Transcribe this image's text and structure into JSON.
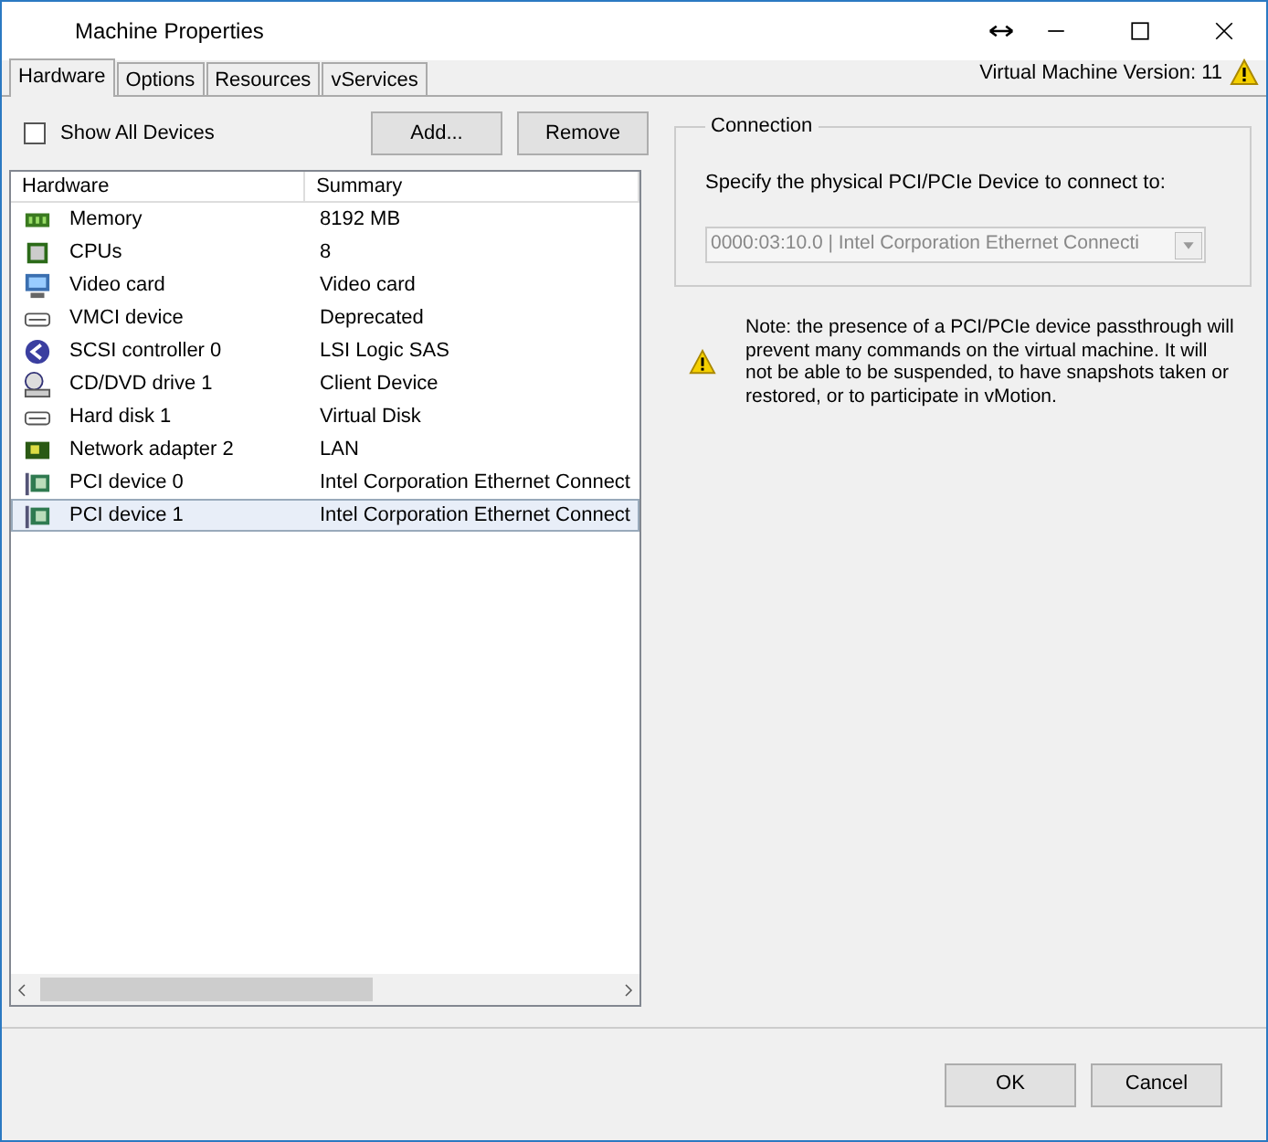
{
  "window": {
    "title": "Machine Properties"
  },
  "tabs": [
    {
      "label": "Hardware",
      "selected": true
    },
    {
      "label": "Options",
      "selected": false
    },
    {
      "label": "Resources",
      "selected": false
    },
    {
      "label": "vServices",
      "selected": false
    }
  ],
  "version": "Virtual Machine Version: 11",
  "show_all_devices": {
    "label": "Show All Devices",
    "checked": false
  },
  "buttons": [
    "Add...",
    "Remove"
  ],
  "table": {
    "columns": [
      "Hardware",
      "Summary"
    ],
    "rows": [
      {
        "kind": "memory",
        "hardware": "Memory",
        "summary": "8192 MB",
        "selected": false
      },
      {
        "kind": "cpu",
        "hardware": "CPUs",
        "summary": "8",
        "selected": false
      },
      {
        "kind": "monitor",
        "hardware": "Video card",
        "summary": "Video card",
        "selected": false
      },
      {
        "kind": "drive",
        "hardware": "VMCI device",
        "summary": "Deprecated",
        "selected": false
      },
      {
        "kind": "scsi",
        "hardware": "SCSI controller 0",
        "summary": "LSI Logic SAS",
        "selected": false
      },
      {
        "kind": "cd",
        "hardware": "CD/DVD drive 1",
        "summary": "Client Device",
        "selected": false
      },
      {
        "kind": "drive",
        "hardware": "Hard disk 1",
        "summary": "Virtual Disk",
        "selected": false
      },
      {
        "kind": "nic",
        "hardware": "Network adapter 2",
        "summary": "LAN",
        "selected": false
      },
      {
        "kind": "pci",
        "hardware": "PCI device 0",
        "summary": "Intel Corporation Ethernet Connect",
        "selected": false
      },
      {
        "kind": "pci",
        "hardware": "PCI device 1",
        "summary": "Intel Corporation Ethernet Connect",
        "selected": true
      }
    ]
  },
  "connection": {
    "legend": "Connection",
    "prompt": "Specify the physical PCI/PCIe Device to connect to:",
    "device": "0000:03:10.0 | Intel Corporation Ethernet Connecti",
    "disabled": true
  },
  "note": "Note: the presence of a PCI/PCIe device passthrough will prevent many commands on the virtual machine. It will not be able to be suspended, to have snapshots taken or restored, or to participate in vMotion.",
  "footer_buttons": [
    "OK",
    "Cancel"
  ]
}
